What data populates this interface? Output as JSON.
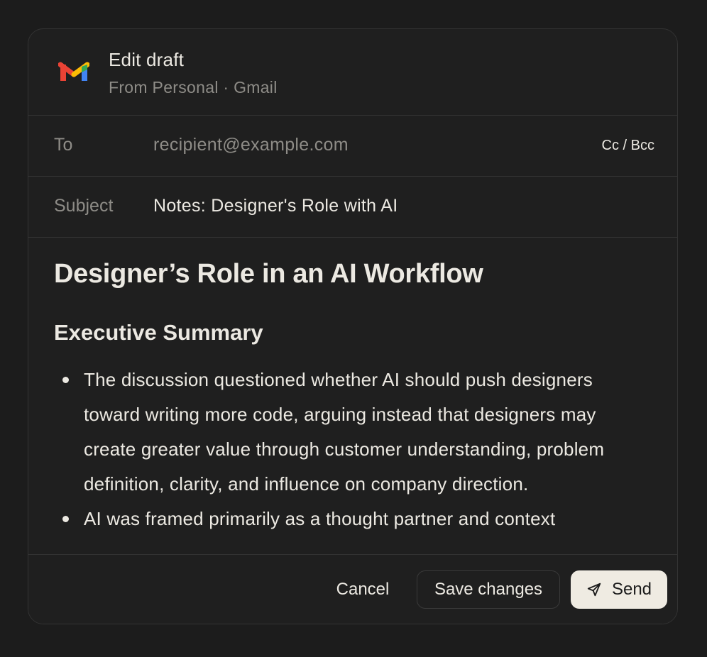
{
  "header": {
    "title": "Edit draft",
    "subtitle": "From Personal · Gmail",
    "logo_icon": "gmail-logo-icon",
    "logo_colors": [
      "#ea4335",
      "#fbbc04",
      "#34a853",
      "#4285f4"
    ]
  },
  "to_field": {
    "label": "To",
    "placeholder": "recipient@example.com",
    "value": "",
    "cc_bcc_label": "Cc / Bcc"
  },
  "subject_field": {
    "label": "Subject",
    "value": "Notes: Designer's Role with AI"
  },
  "body": {
    "heading": "Designer’s Role in an AI Workflow",
    "section_heading": "Executive Summary",
    "bullets": [
      "The discussion questioned whether AI should push designers toward writing more code, arguing instead that designers may create greater value through customer understanding, problem definition, clarity, and influence on company direction.",
      "AI was framed primarily as a thought partner and context"
    ]
  },
  "footer": {
    "cancel_label": "Cancel",
    "save_label": "Save changes",
    "send_label": "Send",
    "send_icon": "paper-plane-icon"
  },
  "colors": {
    "background": "#1c1c1c",
    "dialog": "#1f1f1f",
    "border": "#333333",
    "text": "#ece9e2",
    "muted": "#8e8c87",
    "send_button": "#efebe2"
  }
}
